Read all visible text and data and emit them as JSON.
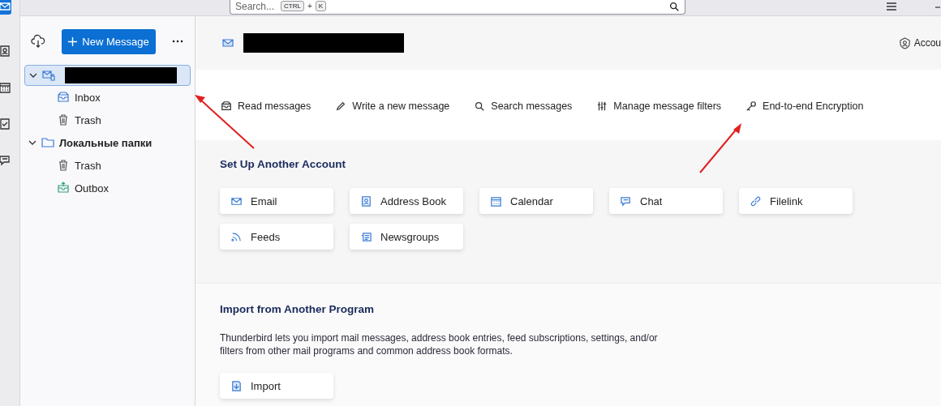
{
  "spaces_bar": {
    "items": [
      {
        "kind": "mail",
        "selected": true
      },
      {
        "kind": "contacts",
        "selected": false
      },
      {
        "kind": "calendar",
        "selected": false
      },
      {
        "kind": "tasks",
        "selected": false
      },
      {
        "kind": "chat",
        "selected": false
      }
    ]
  },
  "top_bar": {
    "search": {
      "placeholder": "Search...",
      "shortcut": [
        {
          "kind": "key",
          "text": "CTRL"
        },
        {
          "kind": "plus",
          "text": "+"
        },
        {
          "kind": "key",
          "text": "K"
        }
      ]
    }
  },
  "folder_pane": {
    "new_message_button": "New Message",
    "tree": [
      {
        "kind": "account",
        "expanded": true,
        "selected": true,
        "children": [
          {
            "kind": "inbox",
            "label": "Inbox"
          },
          {
            "kind": "trash",
            "label": "Trash"
          }
        ]
      },
      {
        "kind": "local",
        "label": "Локальные папки",
        "expanded": true,
        "selected": false,
        "children": [
          {
            "kind": "trash",
            "label": "Trash"
          },
          {
            "kind": "outbox",
            "label": "Outbox"
          }
        ]
      }
    ]
  },
  "header": {
    "account_settings": "Accou"
  },
  "actions": [
    {
      "kind": "read",
      "label": "Read messages"
    },
    {
      "kind": "write",
      "label": "Write a new message"
    },
    {
      "kind": "search",
      "label": "Search messages"
    },
    {
      "kind": "filters",
      "label": "Manage message filters"
    },
    {
      "kind": "key",
      "label": "End-to-end Encryption"
    }
  ],
  "setup": {
    "title": "Set Up Another Account",
    "cards": [
      {
        "kind": "email",
        "label": "Email"
      },
      {
        "kind": "addressbook",
        "label": "Address Book"
      },
      {
        "kind": "calendar",
        "label": "Calendar"
      },
      {
        "kind": "chat",
        "label": "Chat"
      },
      {
        "kind": "filelink",
        "label": "Filelink"
      },
      {
        "kind": "feeds",
        "label": "Feeds"
      },
      {
        "kind": "newsgroups",
        "label": "Newsgroups"
      }
    ]
  },
  "import": {
    "title": "Import from Another Program",
    "description": "Thunderbird lets you import mail messages, address book entries, feed subscriptions, settings, and/or filters from other mail programs and common address book formats.",
    "button": "Import"
  }
}
